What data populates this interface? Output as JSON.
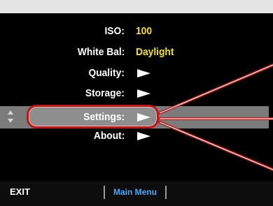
{
  "menu": {
    "items": [
      {
        "label": "ISO:",
        "value": "100",
        "submenu": false
      },
      {
        "label": "White Bal:",
        "value": "Daylight",
        "submenu": false
      },
      {
        "label": "Quality:",
        "value": "",
        "submenu": true
      },
      {
        "label": "Storage:",
        "value": "",
        "submenu": true
      },
      {
        "label": "Settings:",
        "value": "",
        "submenu": true,
        "selected": true
      },
      {
        "label": "About:",
        "value": "",
        "submenu": true
      }
    ]
  },
  "softkeys": {
    "left": "EXIT",
    "center": "Main Menu"
  },
  "colors": {
    "value_text": "#f5e600",
    "highlight_bar": "#7b7b7b",
    "callout": "#c81212",
    "softkey_center": "#3fa9ff"
  }
}
